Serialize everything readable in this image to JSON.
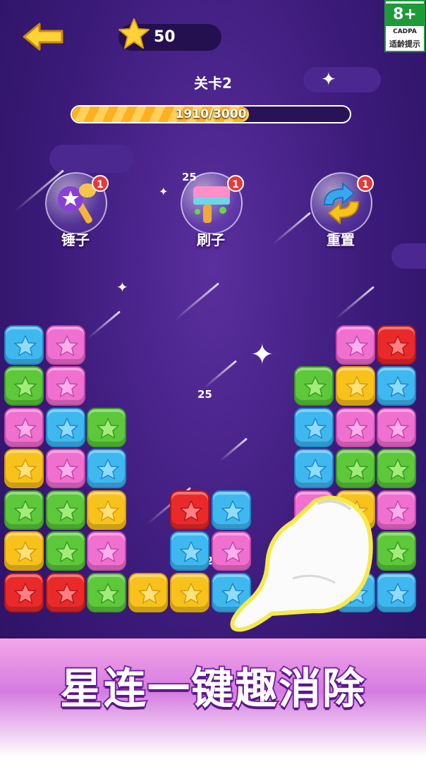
{
  "header": {
    "score": "50",
    "age_rating": "8+",
    "rating_org": "CADPA",
    "rating_tip": "适龄提示"
  },
  "level": {
    "label": "关卡2",
    "progress_text": "1910/3000",
    "progress_value": 1910,
    "progress_max": 3000
  },
  "tools": [
    {
      "label": "锤子",
      "count": "1",
      "icon": "hammer-icon"
    },
    {
      "label": "刷子",
      "count": "1",
      "icon": "brush-icon"
    },
    {
      "label": "重置",
      "count": "1",
      "icon": "reset-icon"
    }
  ],
  "floating_scores": [
    "25",
    "25",
    "25"
  ],
  "banner": {
    "title": "星连一键趣消除"
  },
  "colors": {
    "blue": "#3fb8f0",
    "pink": "#f070d0",
    "green": "#5cc83a",
    "yellow": "#f7c21c",
    "red": "#ea2a2a",
    "accent_purple": "#7a22a8",
    "progress_orange": "#ffb020"
  },
  "board": {
    "columns": [
      [
        "blue",
        "green",
        "pink",
        "yellow",
        "green",
        "yellow",
        "red"
      ],
      [
        "pink",
        "pink",
        "blue",
        "pink",
        "green",
        "green",
        "red"
      ],
      [
        "",
        "",
        "green",
        "blue",
        "yellow",
        "pink",
        "green"
      ],
      [
        "",
        "",
        "",
        "",
        "",
        "",
        "yellow"
      ],
      [
        "",
        "",
        "",
        "",
        "red",
        "blue",
        "yellow"
      ],
      [
        "",
        "",
        "",
        "",
        "blue",
        "pink",
        "blue"
      ],
      [
        "",
        "",
        "",
        "",
        "",
        "",
        ""
      ],
      [
        "",
        "green",
        "blue",
        "blue",
        "pink",
        "",
        ""
      ],
      [
        "pink",
        "yellow",
        "pink",
        "green",
        "yellow",
        "",
        "blue"
      ],
      [
        "red",
        "blue",
        "pink",
        "green",
        "pink",
        "green",
        "blue"
      ]
    ]
  }
}
